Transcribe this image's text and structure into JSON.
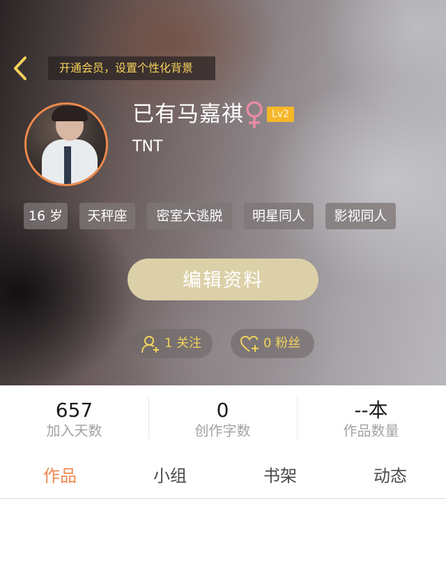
{
  "header": {
    "vip_banner": "开通会员，设置个性化背景",
    "username": "已有马嘉祺",
    "gender_symbol": "♀",
    "level": "Lv2",
    "subtitle": "TNT"
  },
  "tags": [
    "16 岁",
    "天秤座",
    "密室大逃脱",
    "明星同人",
    "影视同人"
  ],
  "edit_button": "编辑资料",
  "follow": {
    "count_label": "1 关注",
    "icon": "add-user-icon"
  },
  "fans": {
    "count_label": "0 粉丝",
    "icon": "heart-plus-icon"
  },
  "stats": [
    {
      "value": "657",
      "label": "加入天数"
    },
    {
      "value": "0",
      "label": "创作字数"
    },
    {
      "value": "--本",
      "label": "作品数量"
    }
  ],
  "tabs": [
    {
      "label": "作品",
      "active": true
    },
    {
      "label": "小组",
      "active": false
    },
    {
      "label": "书架",
      "active": false
    },
    {
      "label": "动态",
      "active": false
    }
  ],
  "colors": {
    "accent": "#f0884e",
    "vip_text": "#f7d25a",
    "level_badge": "#f5b728",
    "edit_button": "#dcd0a8",
    "gender": "#e88aa3"
  }
}
